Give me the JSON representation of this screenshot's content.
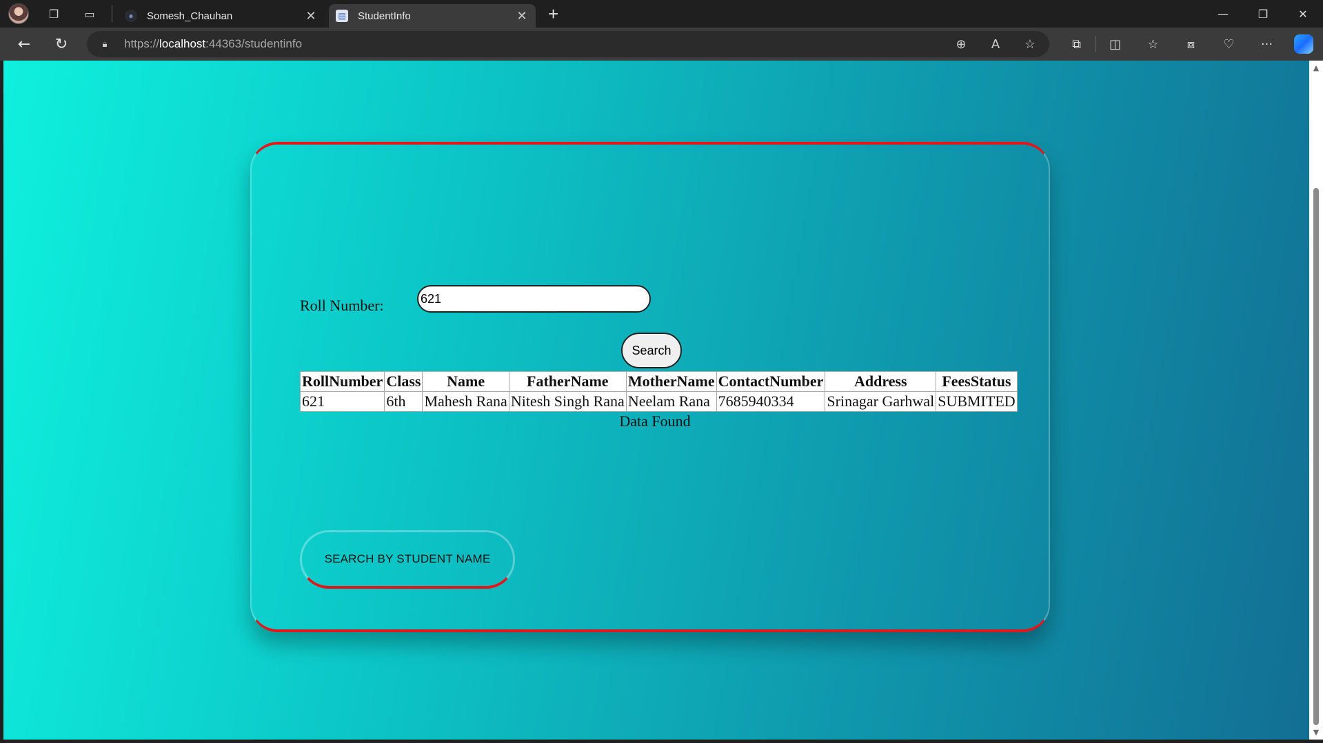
{
  "browser": {
    "tabs": [
      {
        "title": "Somesh_Chauhan",
        "active": false
      },
      {
        "title": "StudentInfo",
        "active": true
      }
    ],
    "url_prefix": "https://",
    "url_host": "localhost",
    "url_rest": ":44363/studentinfo",
    "icons": {
      "profile": "profile-avatar-icon",
      "workspaces": "workspaces-icon",
      "tab_actions": "tab-actions-icon",
      "new_tab": "plus-icon",
      "back": "back-arrow-icon",
      "reload": "reload-icon",
      "lock": "lock-icon",
      "zoom": "zoom-icon",
      "read_aloud": "read-aloud-icon",
      "favorite": "star-icon",
      "extensions": "extensions-icon",
      "split_screen": "split-screen-icon",
      "favorites": "favorites-icon",
      "collections": "collections-icon",
      "browser_essentials": "heart-pulse-icon",
      "more": "more-icon",
      "copilot": "copilot-icon"
    }
  },
  "page": {
    "roll_label": "Roll Number:",
    "roll_input_value": "621",
    "search_button": "Search",
    "table": {
      "headers": [
        "RollNumber",
        "Class",
        "Name",
        "FatherName",
        "MotherName",
        "ContactNumber",
        "Address",
        "FeesStatus"
      ],
      "rows": [
        [
          "621",
          "6th",
          "Mahesh Rana",
          "Nitesh Singh Rana",
          "Neelam Rana",
          "7685940334",
          "Srinagar Garhwal",
          "SUBMITED"
        ]
      ]
    },
    "status": "Data Found",
    "search_by_name_button": "SEARCH BY STUDENT NAME"
  },
  "colors": {
    "gradient_start": "#0ff0de",
    "gradient_end": "#126f93",
    "accent_border": "#e3161b"
  }
}
